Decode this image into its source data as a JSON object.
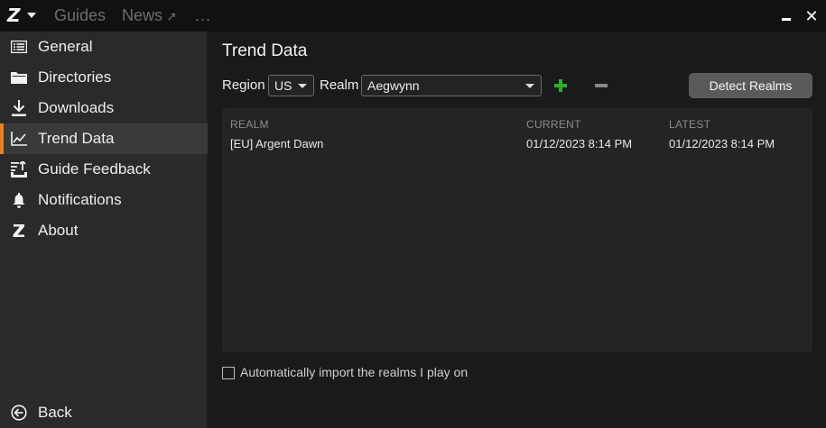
{
  "titlebar": {
    "logo_text": "Z",
    "tabs": [
      {
        "label": "Guides"
      },
      {
        "label": "News",
        "icon": "external-link-icon",
        "icon_glyph": "↗"
      },
      {
        "label": "..."
      }
    ],
    "minimize_icon": "minimize-icon",
    "close_glyph": "✕"
  },
  "sidebar": {
    "items": [
      {
        "label": "General",
        "icon": "list-icon"
      },
      {
        "label": "Directories",
        "icon": "folder-icon"
      },
      {
        "label": "Downloads",
        "icon": "download-icon"
      },
      {
        "label": "Trend Data",
        "icon": "chart-line-icon",
        "active": true
      },
      {
        "label": "Guide Feedback",
        "icon": "feedback-upload-icon"
      },
      {
        "label": "Notifications",
        "icon": "bell-icon"
      },
      {
        "label": "About",
        "icon": "z-logo-icon"
      }
    ],
    "back_label": "Back"
  },
  "main": {
    "title": "Trend Data",
    "region_label": "Region",
    "region_value": "US",
    "realm_label": "Realm",
    "realm_value": "Aegwynn",
    "detect_label": "Detect Realms",
    "table": {
      "headers": [
        "REALM",
        "CURRENT",
        "LATEST"
      ],
      "rows": [
        {
          "realm": "[EU] Argent Dawn",
          "current": "01/12/2023 8:14 PM",
          "latest": "01/12/2023 8:14 PM"
        }
      ]
    },
    "auto_import_label": "Automatically import the realms I play on",
    "auto_import_checked": false
  },
  "colors": {
    "accent": "#e8841f",
    "add_green": "#2fae2a",
    "sidebar_bg": "#2a2a2a",
    "main_bg": "#1a1a1a"
  }
}
